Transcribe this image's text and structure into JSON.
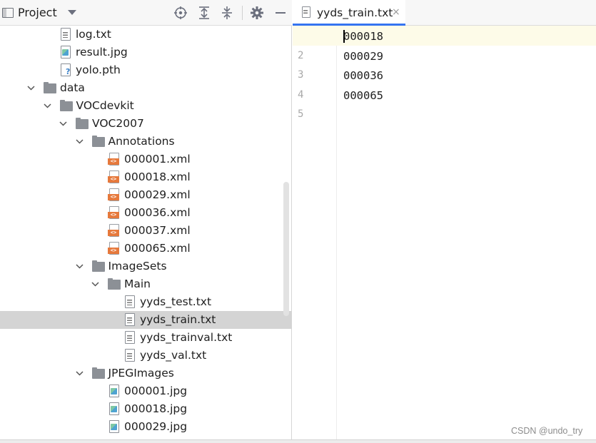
{
  "project_panel": {
    "title": "Project",
    "toolbar_icons": [
      "locate-icon",
      "expand-all-icon",
      "collapse-all-icon",
      "gear-icon",
      "hide-icon"
    ]
  },
  "tree": [
    {
      "label": "log.txt",
      "kind": "txt",
      "depth": 3,
      "expanded": null
    },
    {
      "label": "result.jpg",
      "kind": "jpg",
      "depth": 3,
      "expanded": null
    },
    {
      "label": "yolo.pth",
      "kind": "pth",
      "depth": 3,
      "expanded": null
    },
    {
      "label": "data",
      "kind": "folder",
      "depth": 1,
      "expanded": true
    },
    {
      "label": "VOCdevkit",
      "kind": "folder",
      "depth": 2,
      "expanded": true
    },
    {
      "label": "VOC2007",
      "kind": "folder",
      "depth": 3,
      "expanded": true
    },
    {
      "label": "Annotations",
      "kind": "folder",
      "depth": 4,
      "expanded": true
    },
    {
      "label": "000001.xml",
      "kind": "xml",
      "depth": 6,
      "expanded": null
    },
    {
      "label": "000018.xml",
      "kind": "xml",
      "depth": 6,
      "expanded": null
    },
    {
      "label": "000029.xml",
      "kind": "xml",
      "depth": 6,
      "expanded": null
    },
    {
      "label": "000036.xml",
      "kind": "xml",
      "depth": 6,
      "expanded": null
    },
    {
      "label": "000037.xml",
      "kind": "xml",
      "depth": 6,
      "expanded": null
    },
    {
      "label": "000065.xml",
      "kind": "xml",
      "depth": 6,
      "expanded": null
    },
    {
      "label": "ImageSets",
      "kind": "folder",
      "depth": 4,
      "expanded": true
    },
    {
      "label": "Main",
      "kind": "folder",
      "depth": 5,
      "expanded": true
    },
    {
      "label": "yyds_test.txt",
      "kind": "txt",
      "depth": 7,
      "expanded": null
    },
    {
      "label": "yyds_train.txt",
      "kind": "txt",
      "depth": 7,
      "expanded": null,
      "selected": true
    },
    {
      "label": "yyds_trainval.txt",
      "kind": "txt",
      "depth": 7,
      "expanded": null
    },
    {
      "label": "yyds_val.txt",
      "kind": "txt",
      "depth": 7,
      "expanded": null
    },
    {
      "label": "JPEGImages",
      "kind": "folder",
      "depth": 4,
      "expanded": true
    },
    {
      "label": "000001.jpg",
      "kind": "jpg",
      "depth": 6,
      "expanded": null
    },
    {
      "label": "000018.jpg",
      "kind": "jpg",
      "depth": 6,
      "expanded": null
    },
    {
      "label": "000029.jpg",
      "kind": "jpg",
      "depth": 6,
      "expanded": null
    }
  ],
  "editor": {
    "tab_label": "yyds_train.txt",
    "tab_close": "×",
    "lines": [
      {
        "num": "1",
        "text": "000018"
      },
      {
        "num": "2",
        "text": "000029"
      },
      {
        "num": "3",
        "text": "000036"
      },
      {
        "num": "4",
        "text": "000065"
      },
      {
        "num": "5",
        "text": ""
      }
    ]
  },
  "watermark": "CSDN @undo_try",
  "colors": {
    "accent": "#3574f0",
    "selection": "#d4d4d4",
    "caret_line": "#fdfbe8",
    "xml_badge": "#e6793c"
  }
}
